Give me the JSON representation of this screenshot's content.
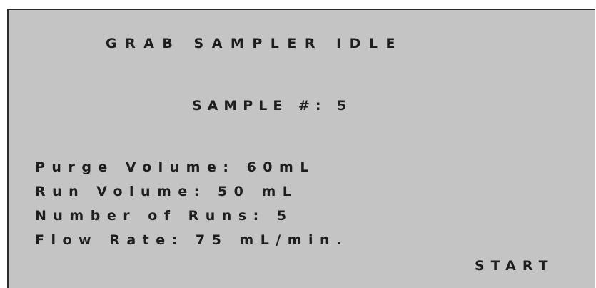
{
  "screen": {
    "status_title": "GRAB SAMPLER IDLE",
    "sample_line": "SAMPLE #: 5",
    "params": {
      "purge_volume": "Purge Volume: 60mL",
      "run_volume": "Run Volume: 50 mL",
      "number_of_runs": "Number of Runs: 5",
      "flow_rate": "Flow Rate: 75 mL/min."
    },
    "start_label": "START"
  },
  "colors": {
    "screen_background": "#c4c4c4",
    "text": "#1e1e1e",
    "border": "#2b2b2b"
  }
}
